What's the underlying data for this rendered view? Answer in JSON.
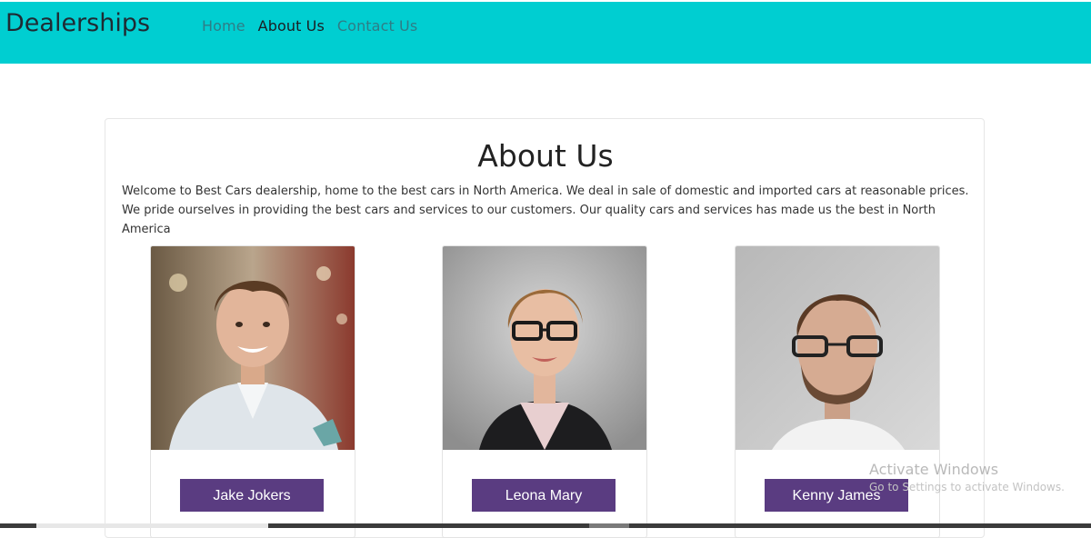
{
  "navbar": {
    "brand": "Dealerships",
    "links": [
      {
        "label": "Home",
        "active": false
      },
      {
        "label": "About Us",
        "active": true
      },
      {
        "label": "Contact Us",
        "active": false
      }
    ],
    "background": "#00ced1"
  },
  "about": {
    "title": "About Us",
    "intro": "Welcome to Best Cars dealership, home to the best cars in North America. We deal in sale of domestic and imported cars at reasonable prices. We pride ourselves in providing the best cars and services to our customers. Our quality cars and services has made us the best in North America"
  },
  "team": [
    {
      "name": "Jake Jokers",
      "photo_icon": "person-photo-icon"
    },
    {
      "name": "Leona Mary",
      "photo_icon": "person-photo-icon"
    },
    {
      "name": "Kenny James",
      "photo_icon": "person-photo-icon"
    }
  ],
  "button_color": "#5a3c81",
  "watermark": {
    "line1": "Activate Windows",
    "line2": "Go to Settings to activate Windows."
  }
}
